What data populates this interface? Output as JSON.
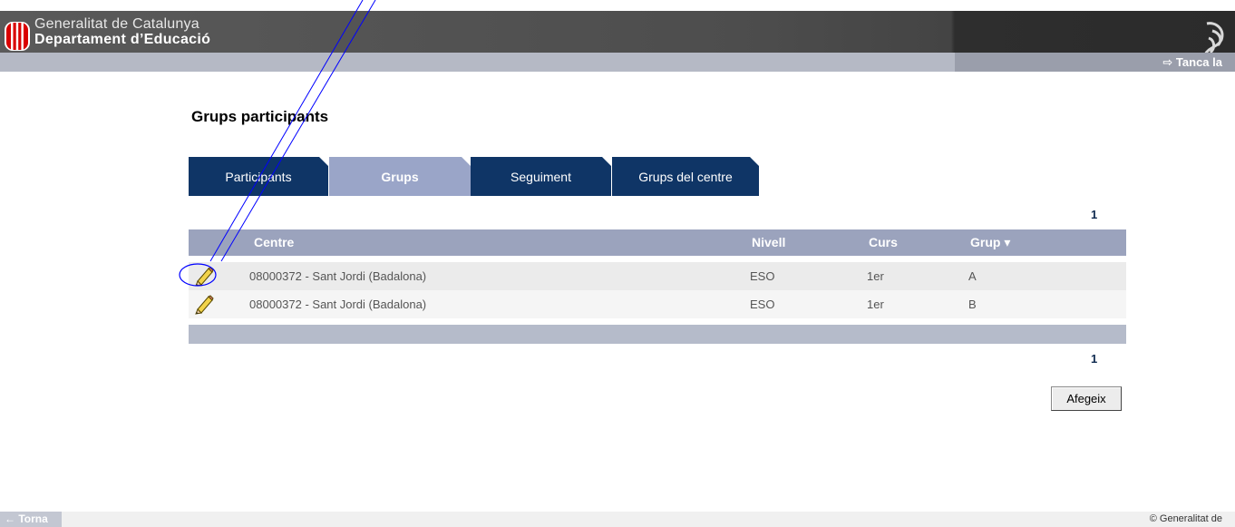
{
  "header": {
    "org_line1": "Generalitat de Catalunya",
    "org_line2": "Departament d’Educació",
    "logo_icon": "catalan-flag-logo-icon",
    "emblem_icon": "generalitat-emblem-icon"
  },
  "subbar": {
    "close_session": "⇨ Tanca la"
  },
  "page": {
    "title": "Grups participants"
  },
  "tabs": [
    {
      "label": "Participants",
      "active": false
    },
    {
      "label": "Grups",
      "active": true
    },
    {
      "label": "Seguiment",
      "active": false
    },
    {
      "label": "Grups del centre",
      "active": false
    }
  ],
  "pager": {
    "top": "1",
    "bottom": "1"
  },
  "table": {
    "columns": {
      "centre": "Centre",
      "nivell": "Nivell",
      "curs": "Curs",
      "grup": "Grup ▾"
    },
    "rows": [
      {
        "centre": "08000372 - Sant Jordi (Badalona)",
        "nivell": "ESO",
        "curs": "1er",
        "grup": "A"
      },
      {
        "centre": "08000372 - Sant Jordi (Badalona)",
        "nivell": "ESO",
        "curs": "1er",
        "grup": "B"
      }
    ],
    "edit_icon": "pencil-edit-icon"
  },
  "actions": {
    "add_label": "Afegeix"
  },
  "footer": {
    "back_label": "← Torna",
    "copyright": "© Generalitat de"
  },
  "colors": {
    "header_dark": "#4d4d4d",
    "tab_dark": "#0f3566",
    "tab_active": "#9aa5c8",
    "table_header": "#9ba3bd",
    "annotation": "#0000ff"
  }
}
